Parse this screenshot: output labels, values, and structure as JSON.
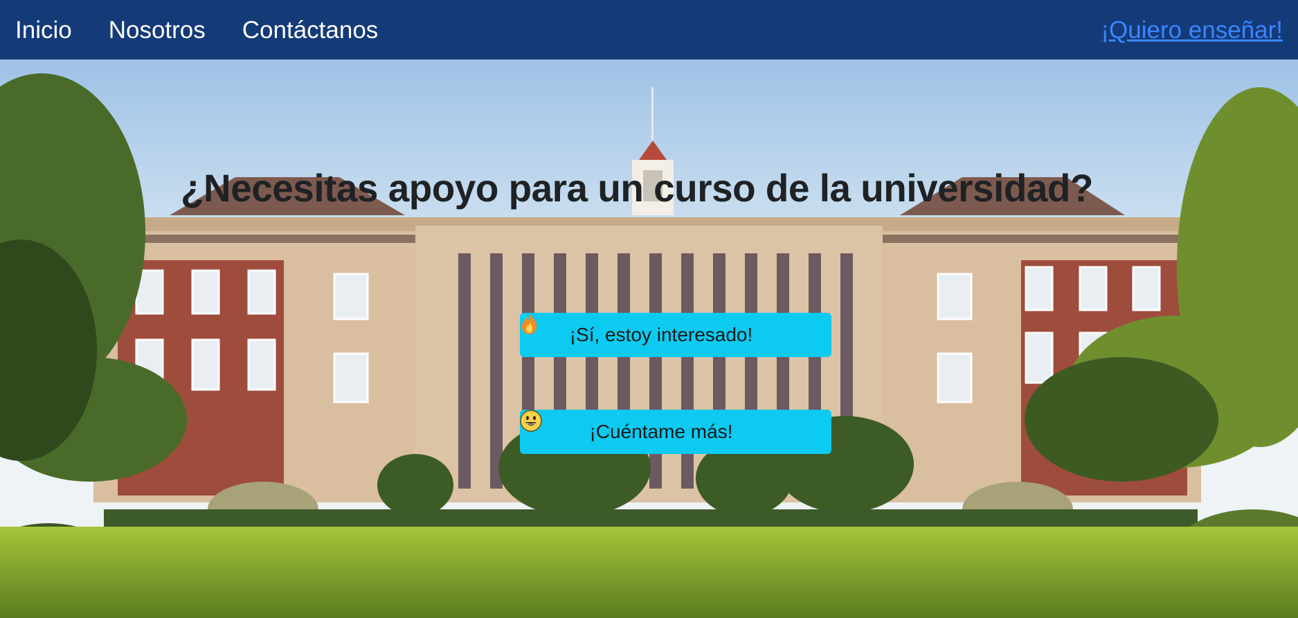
{
  "navbar": {
    "links": [
      {
        "label": "Inicio"
      },
      {
        "label": "Nosotros"
      },
      {
        "label": "Contáctanos"
      }
    ],
    "cta_label": "¡Quiero enseñar!",
    "background_color": "#153a78",
    "cta_color": "#3a86ff"
  },
  "hero": {
    "title": "¿Necesitas apoyo para un curso de la universidad?",
    "background_image": "university-building-photo",
    "buttons": [
      {
        "label": "¡Sí, estoy interesado!",
        "icon": "fire-emoji-icon"
      },
      {
        "label": "¡Cuéntame más!",
        "icon": "grinning-face-emoji-icon"
      }
    ],
    "button_color": "#0dcaf0"
  }
}
